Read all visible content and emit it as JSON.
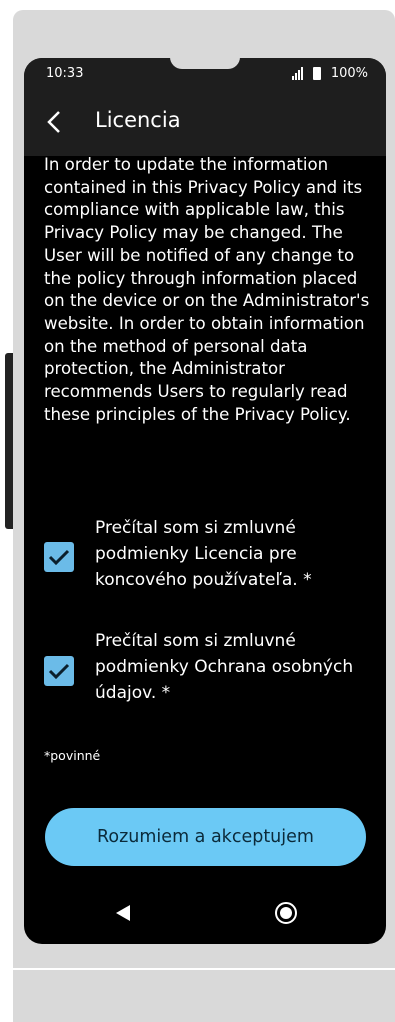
{
  "status_bar": {
    "time": "10:33",
    "battery_percent": "100%"
  },
  "app_bar": {
    "title": "Licencia",
    "back_icon": "chevron-left-icon"
  },
  "content": {
    "policy_text": "In order to update the information contained in this Privacy Policy and its compliance with applicable law, this Privacy Policy may be changed. The User will be notified of any change to the policy through information placed on the device or on the Administrator's website. In order to obtain information on the method of personal data protection, the Administrator recommends Users to regularly read these principles of the Privacy Policy."
  },
  "consents": [
    {
      "label": "Prečítal som si zmluvné podmienky Licencia pre koncového používateľa. *",
      "checked": true
    },
    {
      "label": "Prečítal som si zmluvné podmienky Ochrana osobných údajov. *",
      "checked": true
    }
  ],
  "required_note": "*povinné",
  "accept_button": {
    "label": "Rozumiem a akceptujem"
  },
  "nav": {
    "back_icon": "triangle-back-icon",
    "home_icon": "circle-home-icon"
  },
  "colors": {
    "accent": "#6bc9f5",
    "checkbox": "#6bbbe8",
    "screen_bg": "#000000",
    "bar_bg": "#1e1e1e",
    "device_frame": "#d9d9d9"
  }
}
